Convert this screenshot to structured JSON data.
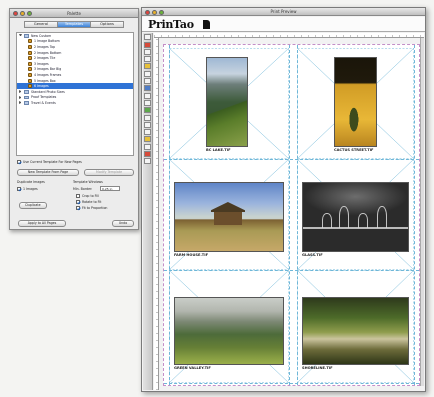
{
  "palette": {
    "title": "Palette",
    "tabs": [
      {
        "label": "General",
        "active": false
      },
      {
        "label": "Templates",
        "active": true
      },
      {
        "label": "Options",
        "active": false
      }
    ],
    "tree": [
      {
        "label": "New Custom",
        "kind": "folder",
        "open": true,
        "indent": 0,
        "selected": false
      },
      {
        "label": "1 Image Bottom",
        "kind": "tpl",
        "indent": 1,
        "selected": false
      },
      {
        "label": "2 Images Top",
        "kind": "tpl",
        "indent": 1,
        "selected": false
      },
      {
        "label": "2 Images Bottom",
        "kind": "tpl",
        "indent": 1,
        "selected": false
      },
      {
        "label": "2 Images Tile",
        "kind": "tpl",
        "indent": 1,
        "selected": false
      },
      {
        "label": "3 Images",
        "kind": "tpl",
        "indent": 1,
        "selected": false
      },
      {
        "label": "3 Images Bar Big",
        "kind": "tpl",
        "indent": 1,
        "selected": false
      },
      {
        "label": "4 Images Frames",
        "kind": "tpl",
        "indent": 1,
        "selected": false
      },
      {
        "label": "5 Images Box",
        "kind": "tpl",
        "indent": 1,
        "selected": false
      },
      {
        "label": "6 Images",
        "kind": "tpl",
        "indent": 1,
        "selected": true
      },
      {
        "label": "Standard Photo Sizes",
        "kind": "folder",
        "open": false,
        "indent": 0,
        "selected": false
      },
      {
        "label": "Proof Templates",
        "kind": "folder",
        "open": false,
        "indent": 0,
        "selected": false
      },
      {
        "label": "Travel & Events",
        "kind": "folder",
        "open": false,
        "indent": 0,
        "selected": false
      }
    ],
    "use_template_label": "Use Current Template For New Pages",
    "use_template_checked": true,
    "new_template_btn": "New Template From Page",
    "modify_template_btn": "Modify Template",
    "duplicate_label": "Duplicate Images",
    "duplicate_checked": true,
    "count_label": "1 Images",
    "duplicate_btn": "Duplicate",
    "windows_label": "Template Windows",
    "min_border_label": "Min. Border:",
    "min_border_value": "0.25 in",
    "crop_label": "Crop to Fill",
    "rotate_label": "Rotate to Fit",
    "fit_label": "Fit to Proportion",
    "apply_btn": "Apply to All Pages",
    "undo_btn": "Undo"
  },
  "preview": {
    "title": "Print Preview",
    "brand": "PrinTao",
    "photos": [
      {
        "caption": "BC LAKE.TIF",
        "art": "lake"
      },
      {
        "caption": "CACTUS STREET.TIF",
        "art": "cactus"
      },
      {
        "caption": "FARM HOUSE.TIF",
        "art": "farm"
      },
      {
        "caption": "GLASS.TIF",
        "art": "glass"
      },
      {
        "caption": "GREEN VALLEY.TIF",
        "art": "valley"
      },
      {
        "caption": "SHORELINE.TIF",
        "art": "shore"
      }
    ]
  },
  "colors": {
    "selection": "#2f73d6",
    "page_border": "#c48fc8",
    "guide": "#6fb7d8"
  }
}
